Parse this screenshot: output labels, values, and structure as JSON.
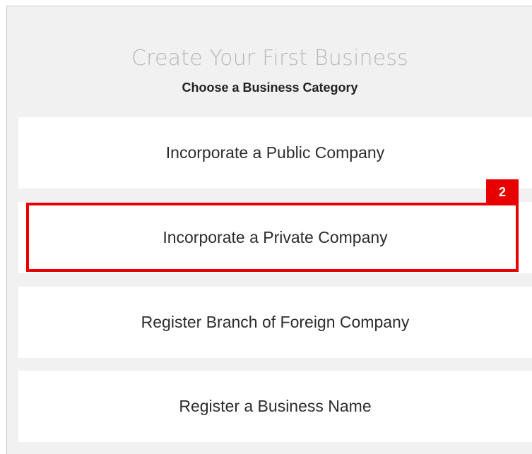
{
  "header": {
    "title": "Create Your First Business",
    "subtitle": "Choose a Business Category"
  },
  "options": [
    {
      "label": "Incorporate a Public Company"
    },
    {
      "label": "Incorporate a Private Company"
    },
    {
      "label": "Register Branch of Foreign Company"
    },
    {
      "label": "Register a Business Name"
    }
  ],
  "annotation": {
    "step_number": "2",
    "highlighted_option": "Incorporate a Private Company",
    "color": "#e80000"
  }
}
